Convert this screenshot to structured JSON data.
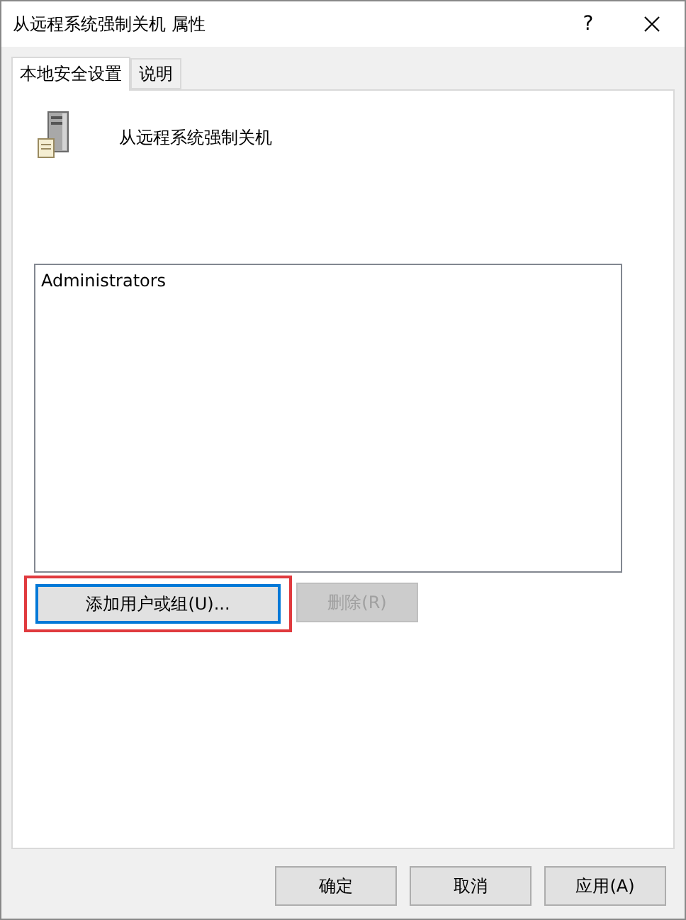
{
  "window": {
    "title": "从远程系统强制关机 属性",
    "help": "?"
  },
  "tabs": [
    {
      "label": "本地安全设置",
      "selected": true
    },
    {
      "label": "说明",
      "selected": false
    }
  ],
  "policy": {
    "name": "从远程系统强制关机"
  },
  "list": {
    "items": [
      {
        "label": "Administrators",
        "selected": false
      }
    ]
  },
  "list_buttons": [
    {
      "label": "添加用户或组(U)...",
      "disabled": false,
      "focused": true,
      "highlighted": true
    },
    {
      "label": "删除(R)",
      "disabled": true,
      "focused": false,
      "highlighted": false
    }
  ],
  "dialog_buttons": [
    {
      "label": "确定",
      "disabled": false
    },
    {
      "label": "取消",
      "disabled": false
    },
    {
      "label": "应用(A)",
      "disabled": false
    }
  ]
}
